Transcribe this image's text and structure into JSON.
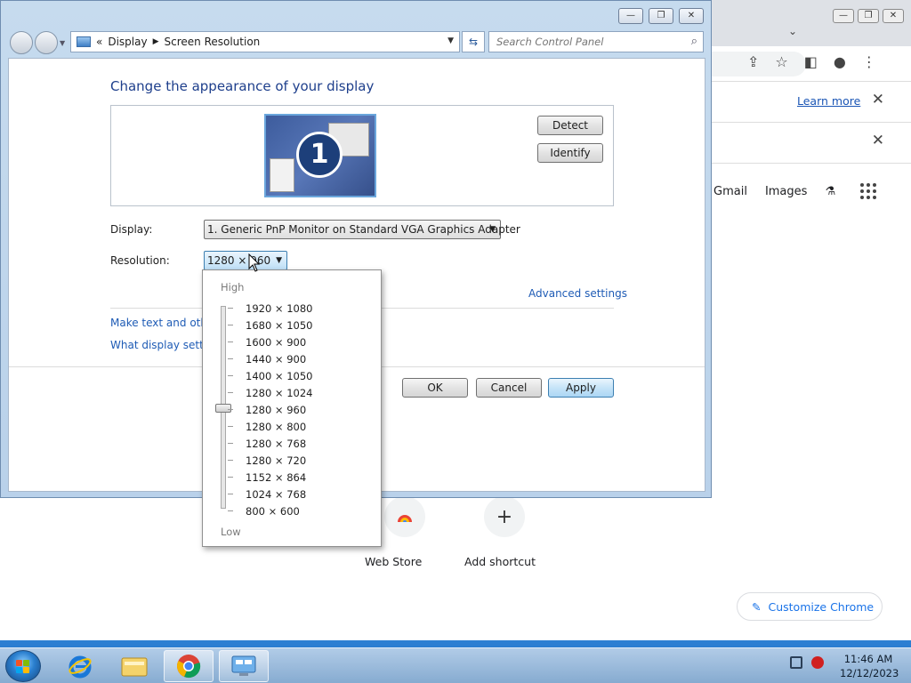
{
  "control_panel": {
    "breadcrumb": {
      "prefix": "«",
      "items": [
        "Display",
        "Screen Resolution"
      ]
    },
    "search": {
      "placeholder": "Search Control Panel"
    },
    "heading": "Change the appearance of your display",
    "monitor_number": "1",
    "buttons": {
      "detect": "Detect",
      "identify": "Identify",
      "ok": "OK",
      "cancel": "Cancel",
      "apply": "Apply"
    },
    "display_label": "Display:",
    "display_value": "1. Generic PnP Monitor on Standard VGA Graphics Adapter",
    "resolution_label": "Resolution:",
    "resolution_value": "1280 × 960",
    "advanced_settings": "Advanced settings",
    "link_text_size": "Make text and other",
    "link_display_settings": "What display setting"
  },
  "resolution_dropdown": {
    "high_label": "High",
    "low_label": "Low",
    "options": [
      "1920 × 1080",
      "1680 × 1050",
      "1600 × 900",
      "1440 × 900",
      "1400 × 1050",
      "1280 × 1024",
      "1280 × 960",
      "1280 × 800",
      "1280 × 768",
      "1280 × 720",
      "1152 × 864",
      "1024 × 768",
      "800 × 600"
    ],
    "selected": "1280 × 960"
  },
  "chrome": {
    "learn_more": "Learn more",
    "gmail": "Gmail",
    "images": "Images",
    "customize": "Customize Chrome",
    "shortcuts": [
      {
        "label": "Web Store",
        "icon": "web-store-icon"
      },
      {
        "label": "Add shortcut",
        "icon": "plus-icon"
      }
    ]
  },
  "taskbar": {
    "time": "11:46 AM",
    "date": "12/12/2023"
  },
  "colors": {
    "link": "#1e5bb5",
    "heading": "#1e3f8c",
    "chrome_blue": "#1a73e8"
  }
}
